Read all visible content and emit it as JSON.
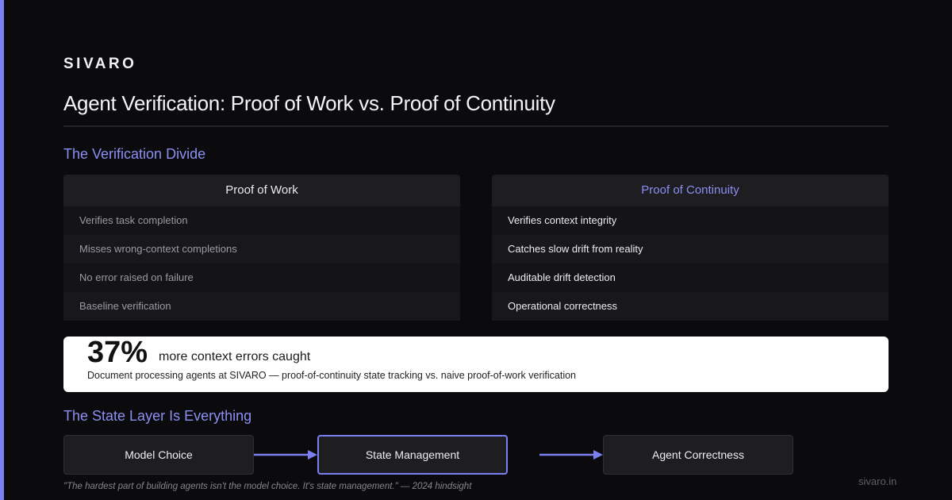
{
  "brand": "SIVARO",
  "title": "Agent Verification: Proof of Work vs. Proof of Continuity",
  "divide": {
    "heading": "The Verification Divide",
    "left": {
      "header": "Proof of Work",
      "rows": [
        "Verifies task completion",
        "Misses wrong-context completions",
        "No error raised on failure",
        "Baseline verification"
      ]
    },
    "right": {
      "header": "Proof of Continuity",
      "rows": [
        "Verifies context integrity",
        "Catches slow drift from reality",
        "Auditable drift detection",
        "Operational correctness"
      ]
    }
  },
  "stat": {
    "value": "37%",
    "label": "more context errors caught",
    "note": "Document processing agents at SIVARO — proof-of-continuity state tracking vs. naive proof-of-work verification"
  },
  "state_layer": {
    "heading": "The State Layer Is Everything",
    "steps": [
      "Model Choice",
      "State Management",
      "Agent Correctness"
    ]
  },
  "quote": "\"The hardest part of building agents isn't the model choice. It's state management.\" — 2024 hindsight",
  "domain": "sivaro.in",
  "colors": {
    "accent": "#7b7ff0",
    "background": "#0b0b0d",
    "card": "#ffffff"
  }
}
